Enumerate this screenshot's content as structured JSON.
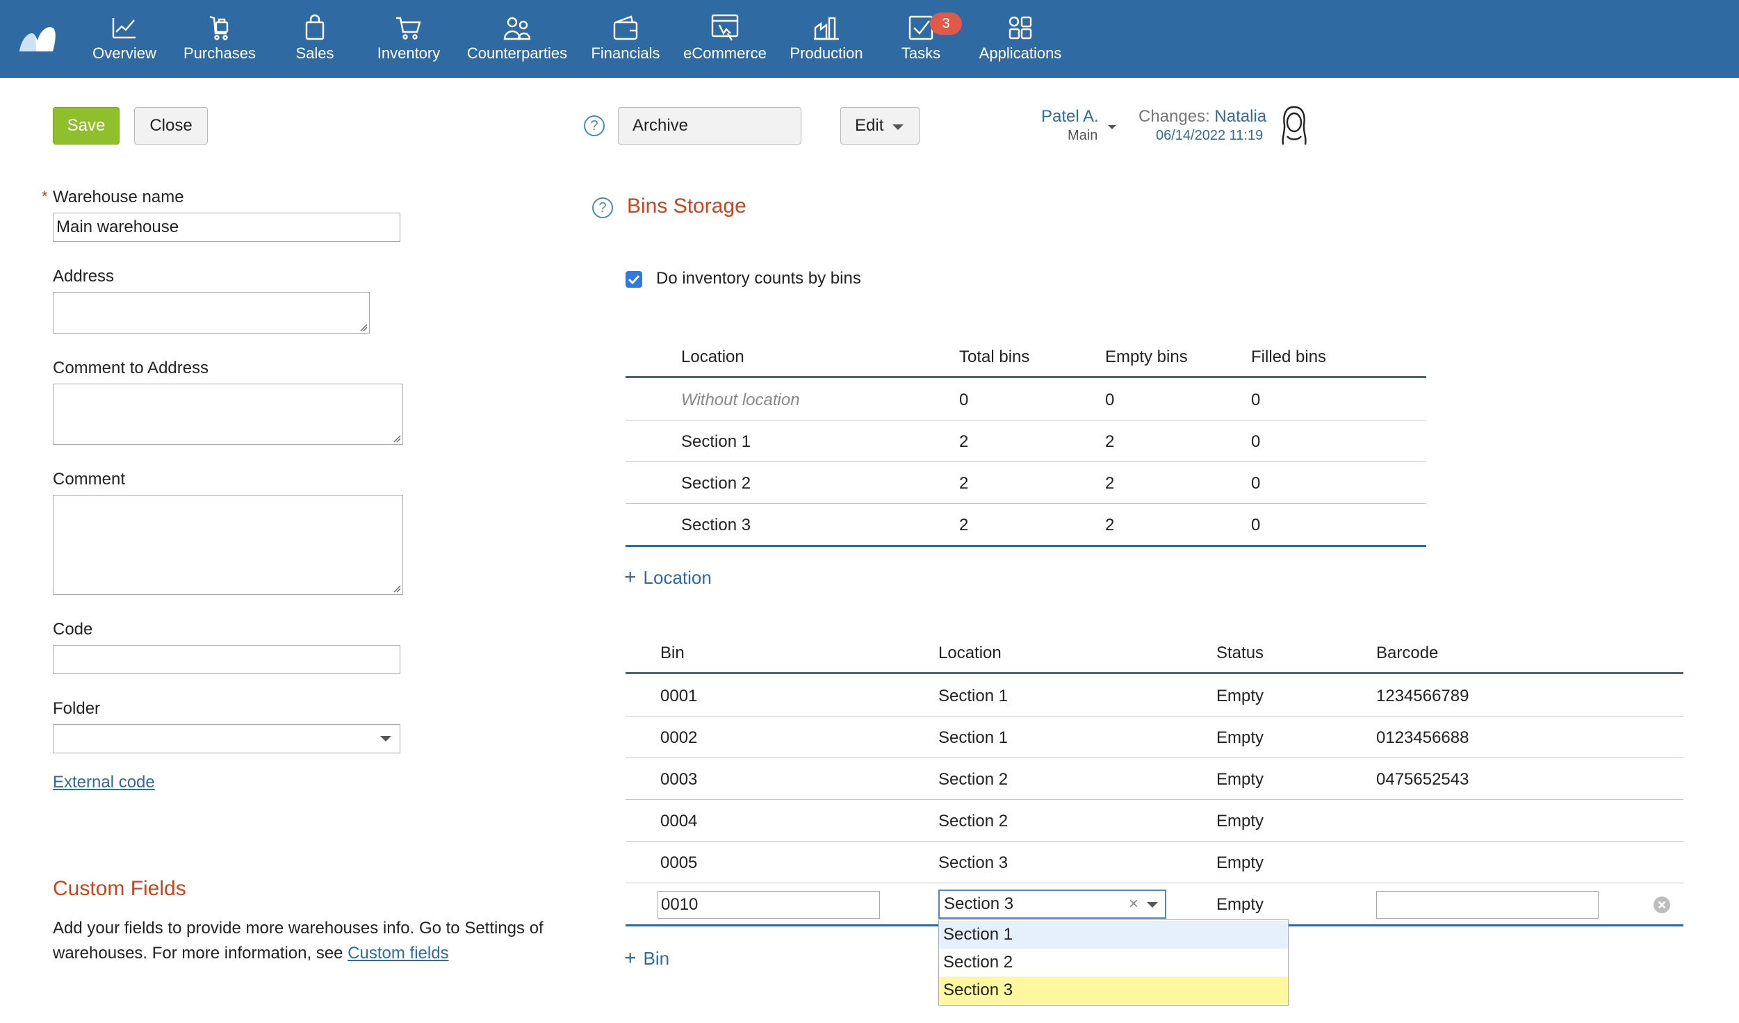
{
  "nav": {
    "items": [
      {
        "label": "Overview",
        "icon": "chart-line-icon"
      },
      {
        "label": "Purchases",
        "icon": "shopping-bag-hand-icon"
      },
      {
        "label": "Sales",
        "icon": "bag-icon"
      },
      {
        "label": "Inventory",
        "icon": "cart-icon"
      },
      {
        "label": "Counterparties",
        "icon": "people-icon"
      },
      {
        "label": "Financials",
        "icon": "wallet-icon"
      },
      {
        "label": "eCommerce",
        "icon": "storefront-icon"
      },
      {
        "label": "Production",
        "icon": "factory-icon"
      },
      {
        "label": "Tasks",
        "icon": "checkbox-icon"
      },
      {
        "label": "Applications",
        "icon": "apps-grid-icon"
      }
    ],
    "tasks_badge": "3"
  },
  "toolbar": {
    "save_label": "Save",
    "close_label": "Close",
    "help": "?",
    "archive_label": "Archive",
    "edit_label": "Edit"
  },
  "owner": {
    "name": "Patel A.",
    "role": "Main",
    "changes_label": "Changes:",
    "changes_by": "Natalia",
    "changes_date": "06/14/2022 11:19"
  },
  "form": {
    "warehouse_name_label": "Warehouse name",
    "required_mark": "*",
    "warehouse_name_value": "Main warehouse",
    "address_label": "Address",
    "address_value": "",
    "comment_address_label": "Comment to Address",
    "comment_address_value": "",
    "comment_label": "Comment",
    "comment_value": "",
    "code_label": "Code",
    "code_value": "",
    "folder_label": "Folder",
    "folder_value": "",
    "external_code_link": "External code"
  },
  "custom_fields": {
    "title": "Custom Fields",
    "text": "Add your fields to provide more warehouses info. Go to Settings of warehouses. For more information, see ",
    "link": "Custom fields"
  },
  "bins_storage": {
    "title": "Bins Storage",
    "checkbox_label": "Do inventory counts by bins",
    "checkbox_checked": true,
    "locations_headers": [
      "Location",
      "Total bins",
      "Empty bins",
      "Filled bins"
    ],
    "locations": [
      {
        "name": "Without location",
        "total": "0",
        "empty": "0",
        "filled": "0"
      },
      {
        "name": "Section 1",
        "total": "2",
        "empty": "2",
        "filled": "0"
      },
      {
        "name": "Section 2",
        "total": "2",
        "empty": "2",
        "filled": "0"
      },
      {
        "name": "Section 3",
        "total": "2",
        "empty": "2",
        "filled": "0"
      }
    ],
    "add_location_label": "Location",
    "bins_headers": [
      "Bin",
      "Location",
      "Status",
      "Barcode"
    ],
    "bins": [
      {
        "bin": "0001",
        "location": "Section 1",
        "status": "Empty",
        "barcode": "1234566789"
      },
      {
        "bin": "0002",
        "location": "Section 1",
        "status": "Empty",
        "barcode": "0123456688"
      },
      {
        "bin": "0003",
        "location": "Section 2",
        "status": "Empty",
        "barcode": "0475652543"
      },
      {
        "bin": "0004",
        "location": "Section 2",
        "status": "Empty",
        "barcode": ""
      },
      {
        "bin": "0005",
        "location": "Section 3",
        "status": "Empty",
        "barcode": ""
      }
    ],
    "editing_row": {
      "bin": "0010",
      "location": "Section 3",
      "status": "Empty",
      "barcode": ""
    },
    "location_options": [
      "Section 1",
      "Section 2",
      "Section 3"
    ],
    "add_bin_label": "Bin"
  },
  "colors": {
    "nav_bg": "#2f6aa3",
    "accent": "#2f6aa3",
    "save_green": "#8fbf2a",
    "title_orange": "#c8461e",
    "badge_red": "#e05a4a",
    "option_highlight": "#fff8a0",
    "option_hover": "#e6f0fa"
  }
}
